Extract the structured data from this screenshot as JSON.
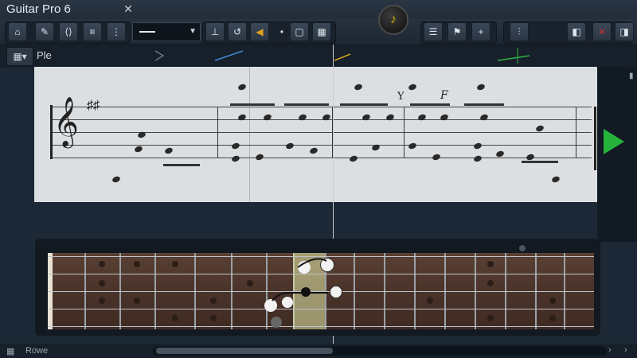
{
  "window": {
    "title": "Guitar Pro 6"
  },
  "toolbar": {
    "home_icon": "home-icon",
    "edit_icon": "edit-icon",
    "arrows_icon": "arrows-icon",
    "combo_value": "—",
    "buttons": [
      "home-icon",
      "pencil-icon",
      "angle-icon",
      "list-icon",
      "list2-icon"
    ]
  },
  "trackbar": {
    "label": "Ple"
  },
  "notation": {
    "chord_symbol": "F",
    "markings": [
      "Y"
    ]
  },
  "statusbar": {
    "label": "Rowe"
  },
  "colors": {
    "accent": "#25b33c",
    "logo": "#e0b000",
    "background": "#1c2836"
  }
}
